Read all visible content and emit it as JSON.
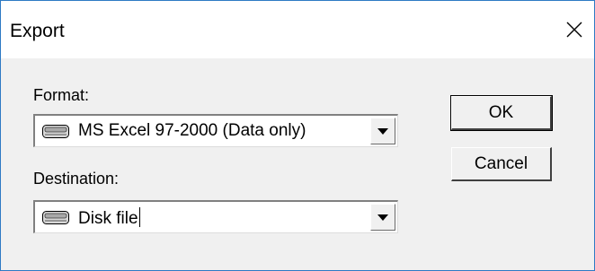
{
  "window": {
    "title": "Export",
    "close_glyph": "✕"
  },
  "format": {
    "label": "Format:",
    "value": "MS Excel 97-2000 (Data only)",
    "icon": "drive-icon"
  },
  "destination": {
    "label": "Destination:",
    "value": "Disk file",
    "icon": "drive-icon"
  },
  "buttons": {
    "ok_label": "OK",
    "cancel_label": "Cancel"
  },
  "colors": {
    "window_border": "#2e7ac4",
    "dialog_bg": "#f0f0f0",
    "titlebar_bg": "#ffffff"
  }
}
